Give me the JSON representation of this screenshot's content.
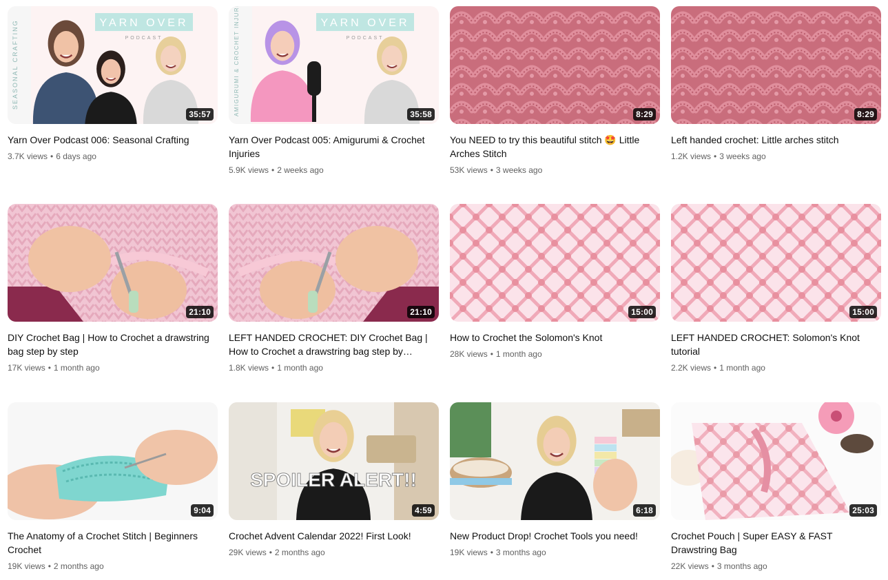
{
  "videos": [
    {
      "title": "Yarn Over Podcast 006: Seasonal Crafting",
      "views": "3.7K views",
      "age": "6 days ago",
      "duration": "35:57",
      "thumb_words": {
        "title": "YARN OVER",
        "sub": "PODCAST",
        "side": "SEASONAL CRAFTING"
      }
    },
    {
      "title": "Yarn Over Podcast 005: Amigurumi & Crochet Injuries",
      "views": "5.9K views",
      "age": "2 weeks ago",
      "duration": "35:58",
      "thumb_words": {
        "title": "YARN OVER",
        "sub": "PODCAST",
        "side": "AMIGURUMI & CROCHET INJURIES"
      }
    },
    {
      "title": "You NEED to try this beautiful stitch 🤩 Little Arches Stitch",
      "views": "53K views",
      "age": "3 weeks ago",
      "duration": "8:29"
    },
    {
      "title": "Left handed crochet: Little arches stitch",
      "views": "1.2K views",
      "age": "3 weeks ago",
      "duration": "8:29"
    },
    {
      "title": "DIY Crochet Bag | How to Crochet a drawstring bag step by step",
      "views": "17K views",
      "age": "1 month ago",
      "duration": "21:10"
    },
    {
      "title": "LEFT HANDED CROCHET: DIY Crochet Bag | How to Crochet a drawstring bag step by…",
      "views": "1.8K views",
      "age": "1 month ago",
      "duration": "21:10"
    },
    {
      "title": "How to Crochet the Solomon's Knot",
      "views": "28K views",
      "age": "1 month ago",
      "duration": "15:00"
    },
    {
      "title": "LEFT HANDED CROCHET: Solomon's Knot tutorial",
      "views": "2.2K views",
      "age": "1 month ago",
      "duration": "15:00"
    },
    {
      "title": "The Anatomy of a Crochet Stitch | Beginners Crochet",
      "views": "19K views",
      "age": "2 months ago",
      "duration": "9:04"
    },
    {
      "title": "Crochet Advent Calendar 2022! First Look!",
      "views": "29K views",
      "age": "2 months ago",
      "duration": "4:59",
      "thumb_words": {
        "overlay": "SPOILER ALERT!!"
      }
    },
    {
      "title": "New Product Drop! Crochet Tools you need!",
      "views": "19K views",
      "age": "3 months ago",
      "duration": "6:18"
    },
    {
      "title": "Crochet Pouch | Super EASY & FAST Drawstring Bag",
      "views": "22K views",
      "age": "3 months ago",
      "duration": "25:03"
    }
  ],
  "separator": "•",
  "colors": {
    "text_primary": "#0f0f0f",
    "text_secondary": "#606060",
    "duration_bg": "#000000",
    "arches_pink": "#d8808e",
    "solomon_pink": "#f2b6c2",
    "bag_pink": "#f3c9d6",
    "teal_yarn": "#7fd6cf",
    "podcast_banner": "#bfe6e2"
  },
  "icons": [
    "person-figure",
    "microphone-icon",
    "crochet-hook",
    "yarn-fabric"
  ]
}
